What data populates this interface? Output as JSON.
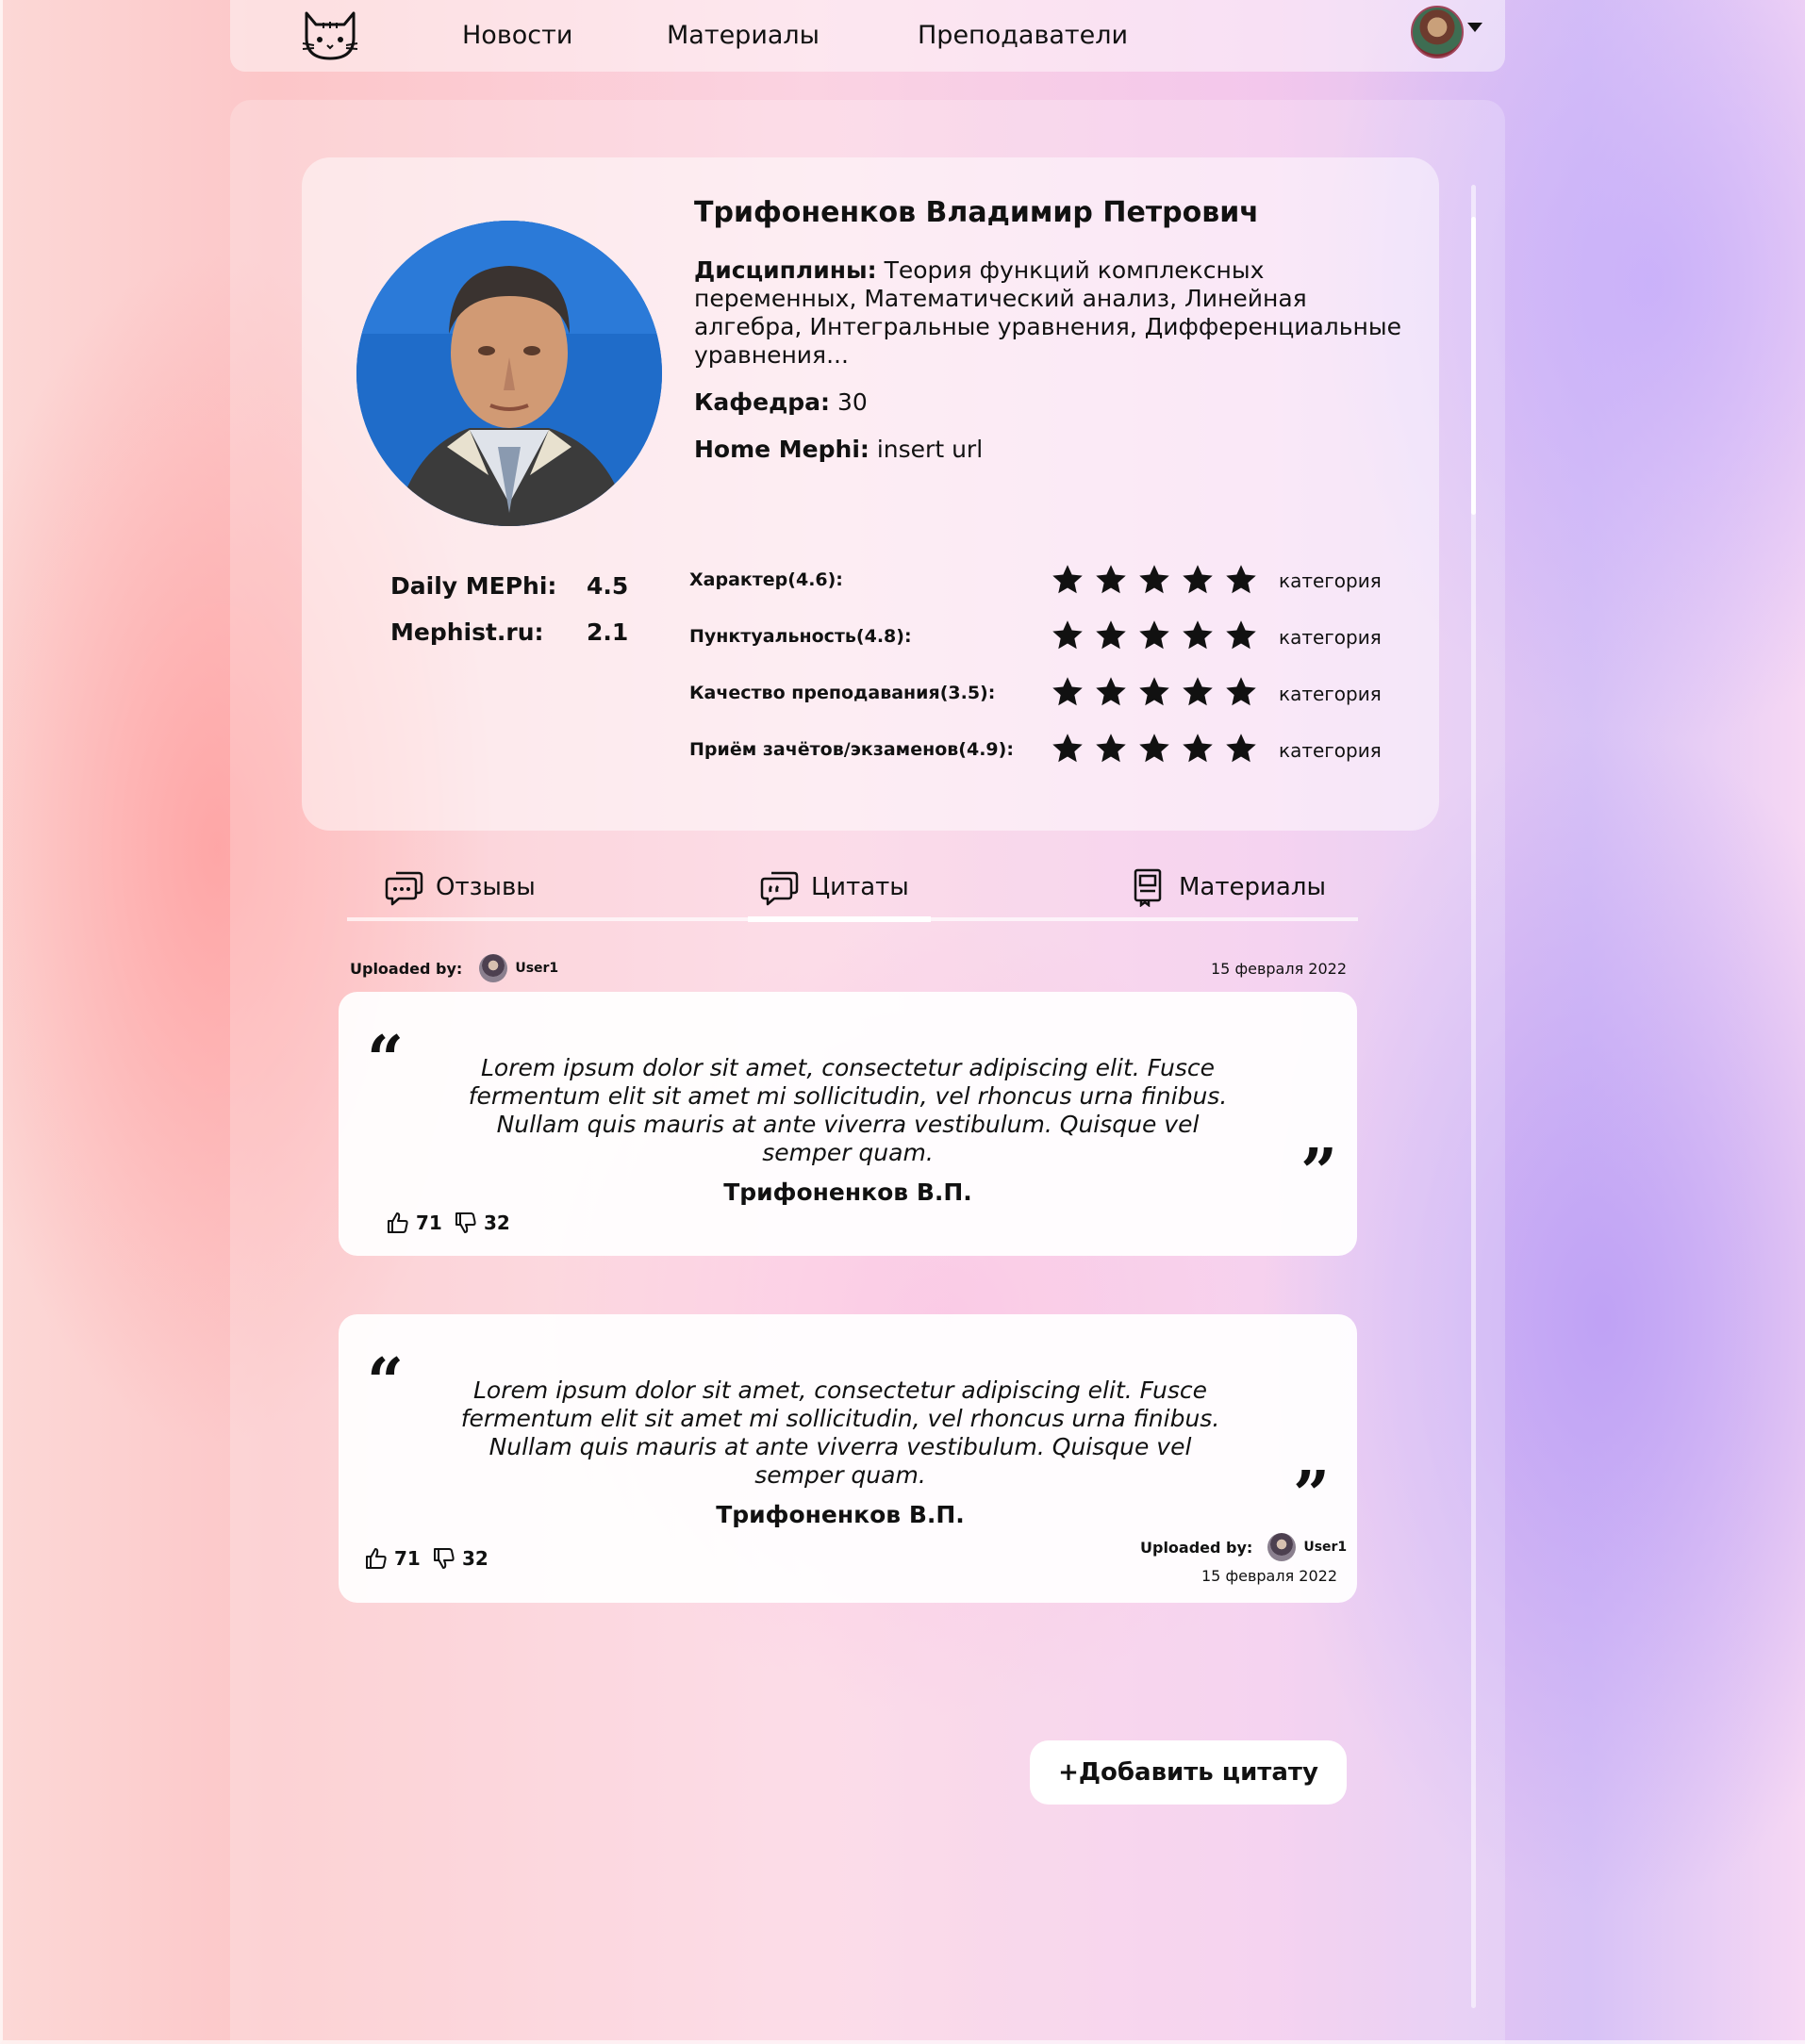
{
  "nav": {
    "links": [
      "Новости",
      "Материалы",
      "Преподаватели"
    ]
  },
  "profile": {
    "name": "Трифоненков Владимир Петрович",
    "disciplines_label": "Дисциплины:",
    "disciplines_value": "Теория функций комплексных переменных, Математический анализ, Линейная алгебра, Интегральные уравнения, Дифференциальные уравнения...",
    "department_label": "Кафедра:",
    "department_value": "30",
    "home_label": "Home Mephi:",
    "home_value": "insert url",
    "scores": [
      {
        "label": "Daily MEPhi:",
        "value": "4.5"
      },
      {
        "label": "Mephist.ru:",
        "value": "2.1"
      }
    ],
    "categories": [
      {
        "label": "Характер(4.6):",
        "rating": 4.6,
        "tag": "категория"
      },
      {
        "label": "Пунктуальность(4.8):",
        "rating": 4.8,
        "tag": "категория"
      },
      {
        "label": "Качество преподавания(3.5):",
        "rating": 3.5,
        "tag": "категория"
      },
      {
        "label": "Приём зачётов/экзаменов(4.9):",
        "rating": 4.9,
        "tag": "категория"
      }
    ]
  },
  "tabs": [
    {
      "label": "Отзывы",
      "icon": "chat-dots-icon"
    },
    {
      "label": "Цитаты",
      "icon": "chat-quote-icon",
      "active": true
    },
    {
      "label": "Материалы",
      "icon": "document-icon"
    }
  ],
  "quotes": [
    {
      "uploaded_label": "Uploaded by:",
      "user": "User1",
      "date": "15 февраля 2022",
      "text": "Lorem ipsum dolor sit amet, consectetur adipiscing elit. Fusce fermentum elit sit amet mi sollicitudin, vel rhoncus urna finibus. Nullam quis mauris at ante viverra vestibulum. Quisque vel semper quam.",
      "author": "Трифоненков В.П.",
      "likes": "71",
      "dislikes": "32"
    },
    {
      "uploaded_label": "Uploaded by:",
      "user": "User1",
      "date": "15 февраля 2022",
      "text": "Lorem ipsum dolor sit amet, consectetur adipiscing elit. Fusce fermentum elit sit amet mi sollicitudin, vel rhoncus urna finibus. Nullam quis mauris at ante viverra vestibulum. Quisque vel semper quam.",
      "author": "Трифоненков В.П.",
      "likes": "71",
      "dislikes": "32"
    }
  ],
  "add_button": "+Добавить цитату",
  "quote_open": "“",
  "quote_close": "”"
}
